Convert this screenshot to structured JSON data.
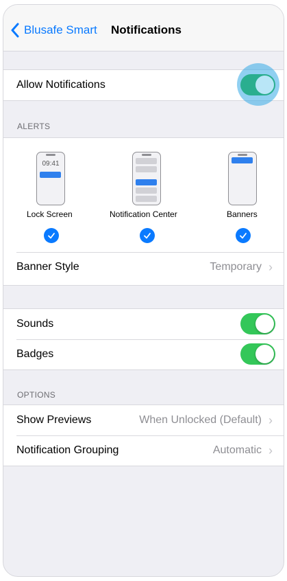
{
  "nav": {
    "back_label": "Blusafe Smart",
    "title": "Notifications"
  },
  "allow": {
    "label": "Allow Notifications",
    "on": true
  },
  "alerts": {
    "header": "ALERTS",
    "lock_screen": {
      "label": "Lock Screen",
      "time": "09:41",
      "checked": true
    },
    "notification_center": {
      "label": "Notification Center",
      "checked": true
    },
    "banners": {
      "label": "Banners",
      "checked": true
    },
    "banner_style": {
      "label": "Banner Style",
      "value": "Temporary"
    }
  },
  "sounds": {
    "label": "Sounds",
    "on": true
  },
  "badges": {
    "label": "Badges",
    "on": true
  },
  "options": {
    "header": "OPTIONS",
    "show_previews": {
      "label": "Show Previews",
      "value": "When Unlocked (Default)"
    },
    "grouping": {
      "label": "Notification Grouping",
      "value": "Automatic"
    }
  },
  "colors": {
    "accent": "#0a7aff",
    "toggle_on": "#34c759",
    "secondary_text": "#8e8e93",
    "background": "#efeff4"
  },
  "icons": {
    "back": "chevron-left-icon",
    "disclosure": "chevron-right-icon",
    "check": "checkmark-icon"
  }
}
